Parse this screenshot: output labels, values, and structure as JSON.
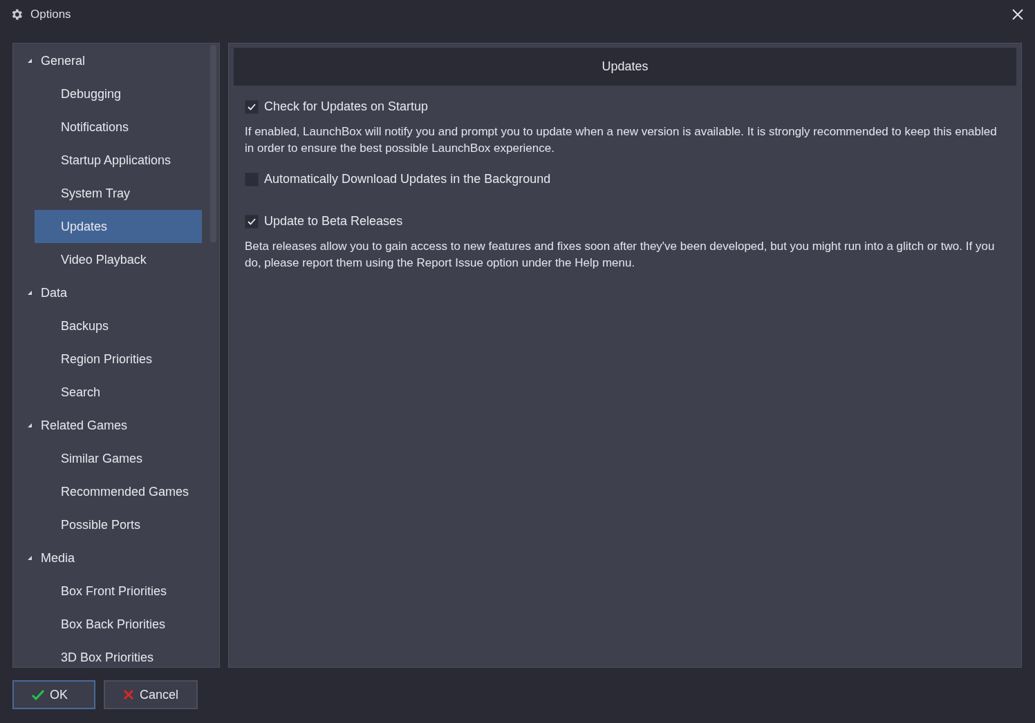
{
  "window": {
    "title": "Options"
  },
  "sidebar": {
    "items": [
      {
        "label": "General",
        "expanded": true,
        "children": [
          {
            "label": "Debugging",
            "selected": false
          },
          {
            "label": "Notifications",
            "selected": false
          },
          {
            "label": "Startup Applications",
            "selected": false
          },
          {
            "label": "System Tray",
            "selected": false
          },
          {
            "label": "Updates",
            "selected": true
          },
          {
            "label": "Video Playback",
            "selected": false
          }
        ]
      },
      {
        "label": "Data",
        "expanded": true,
        "children": [
          {
            "label": "Backups",
            "selected": false
          },
          {
            "label": "Region Priorities",
            "selected": false
          },
          {
            "label": "Search",
            "selected": false
          }
        ]
      },
      {
        "label": "Related Games",
        "expanded": true,
        "children": [
          {
            "label": "Similar Games",
            "selected": false
          },
          {
            "label": "Recommended Games",
            "selected": false
          },
          {
            "label": "Possible Ports",
            "selected": false
          }
        ]
      },
      {
        "label": "Media",
        "expanded": true,
        "children": [
          {
            "label": "Box Front Priorities",
            "selected": false
          },
          {
            "label": "Box Back Priorities",
            "selected": false
          },
          {
            "label": "3D Box Priorities",
            "selected": false
          }
        ]
      }
    ]
  },
  "panel": {
    "title": "Updates",
    "options": [
      {
        "label": "Check for Updates on Startup",
        "checked": true,
        "description": "If enabled, LaunchBox will notify you and prompt you to update when a new version is available. It is strongly recommended to keep this enabled in order to ensure the best possible LaunchBox experience."
      },
      {
        "label": "Automatically Download Updates in the Background",
        "checked": false
      },
      {
        "label": "Update to Beta Releases",
        "checked": true,
        "description": "Beta releases allow you to gain access to new features and fixes soon after they've been developed, but you might run into a glitch or two. If you do, please report them using the Report Issue option under the Help menu."
      }
    ]
  },
  "buttons": [
    {
      "label": "OK",
      "kind": "ok"
    },
    {
      "label": "Cancel",
      "kind": "cancel"
    }
  ]
}
